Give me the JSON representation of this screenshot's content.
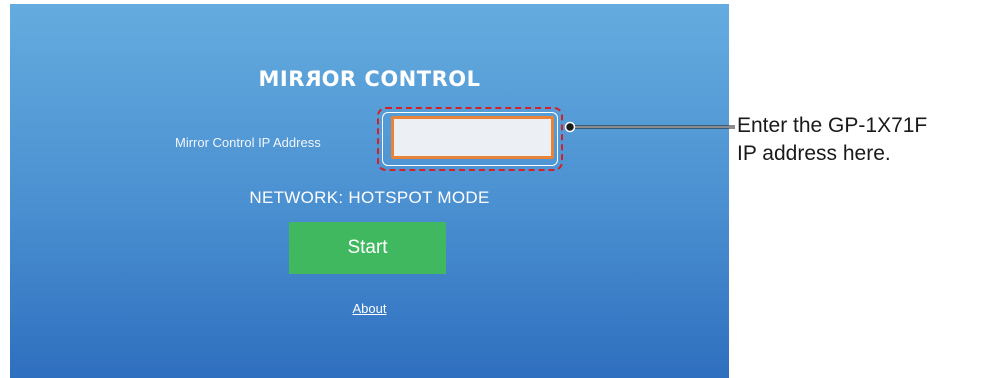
{
  "app": {
    "brand_prefix": "MIR",
    "brand_mirrored": "R",
    "brand_suffix": "OR CONTROL",
    "ip_label": "Mirror Control IP Address",
    "ip_value": "",
    "network_status": "NETWORK: HOTSPOT MODE",
    "start_label": "Start",
    "about_label": "About"
  },
  "callout": {
    "line1": "Enter the GP-1X71F",
    "line2": "IP address here."
  },
  "colors": {
    "screen_top": "#64acdf",
    "screen_bottom": "#2f6fbf",
    "start_button": "#3fb85f",
    "input_border": "#e8833a",
    "highlight_dash": "#d42127"
  }
}
